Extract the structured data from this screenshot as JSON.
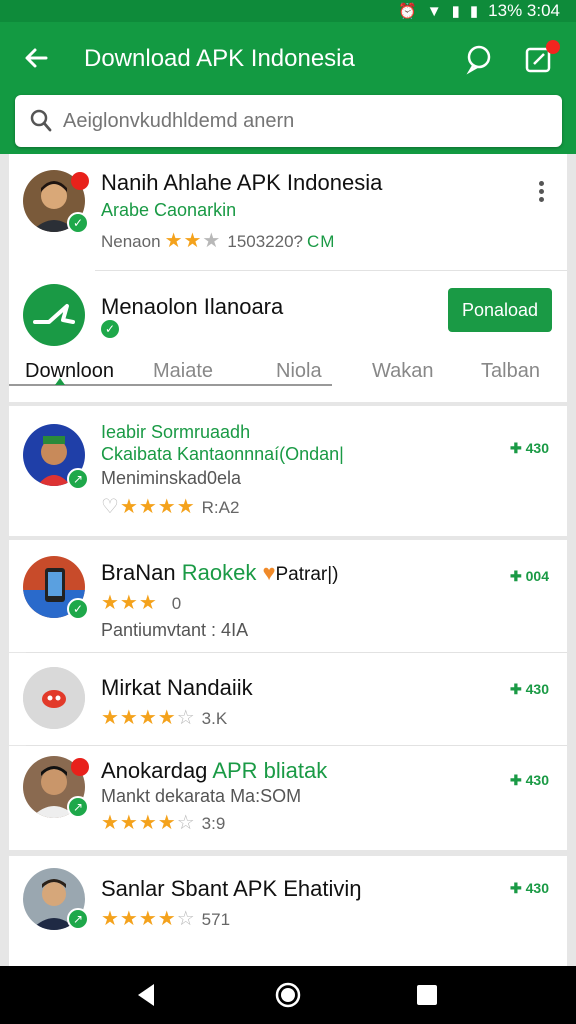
{
  "status_bar": {
    "time": "13% 3:04"
  },
  "header": {
    "title": "Download APK Indonesia",
    "search_placeholder": "Aeiglonvkudhldemd anern"
  },
  "profile": {
    "name": "Nanih Ahlahe APK Indonesia",
    "subtitle": "Arabe Caonarkin",
    "rating_prefix": "Nenaon",
    "rating_value": "1503220?",
    "rating_suffix": "CM",
    "stars": 2
  },
  "featured": {
    "name": "Menaolon Ilanoara",
    "button_label": "Ponaload"
  },
  "tabs": [
    {
      "label": "Downloon"
    },
    {
      "label": "Maiate"
    },
    {
      "label": "Niola"
    },
    {
      "label": "Wakan"
    },
    {
      "label": "Talban"
    }
  ],
  "list": [
    {
      "line1": "Ieabir Sormruaadh",
      "line2": "Ckaibata Kantaonnnaí(Ondan|",
      "line3": "Meniminskad0ela",
      "rating_value": "R:A2",
      "stars": 4,
      "count": "430"
    },
    {
      "name_main": "BraNan",
      "name_hl": "Raokek",
      "name_tail": "Patrar|)",
      "rating_value": "0",
      "line3": "Pantiumvtant :  4IA",
      "stars": 3,
      "count": "004"
    },
    {
      "name_main": "Mirkat Nandaiik",
      "rating_value": "3.K",
      "stars": 4,
      "count": "430"
    },
    {
      "name_main": "Anokardag",
      "name_hl": "APR bliatak",
      "line2": "Mankt dekarata Ma:SOM",
      "rating_value": "3:9",
      "stars": 4,
      "count": "430"
    },
    {
      "name_main": "Sanlar Sbant APK Ehativiŋ",
      "rating_value": "571",
      "stars": 4,
      "count": "430"
    }
  ],
  "colors": {
    "primary": "#139a42",
    "status_bar": "#0e8b3a",
    "accent_red": "#e8211b",
    "star": "#f4a21c"
  }
}
